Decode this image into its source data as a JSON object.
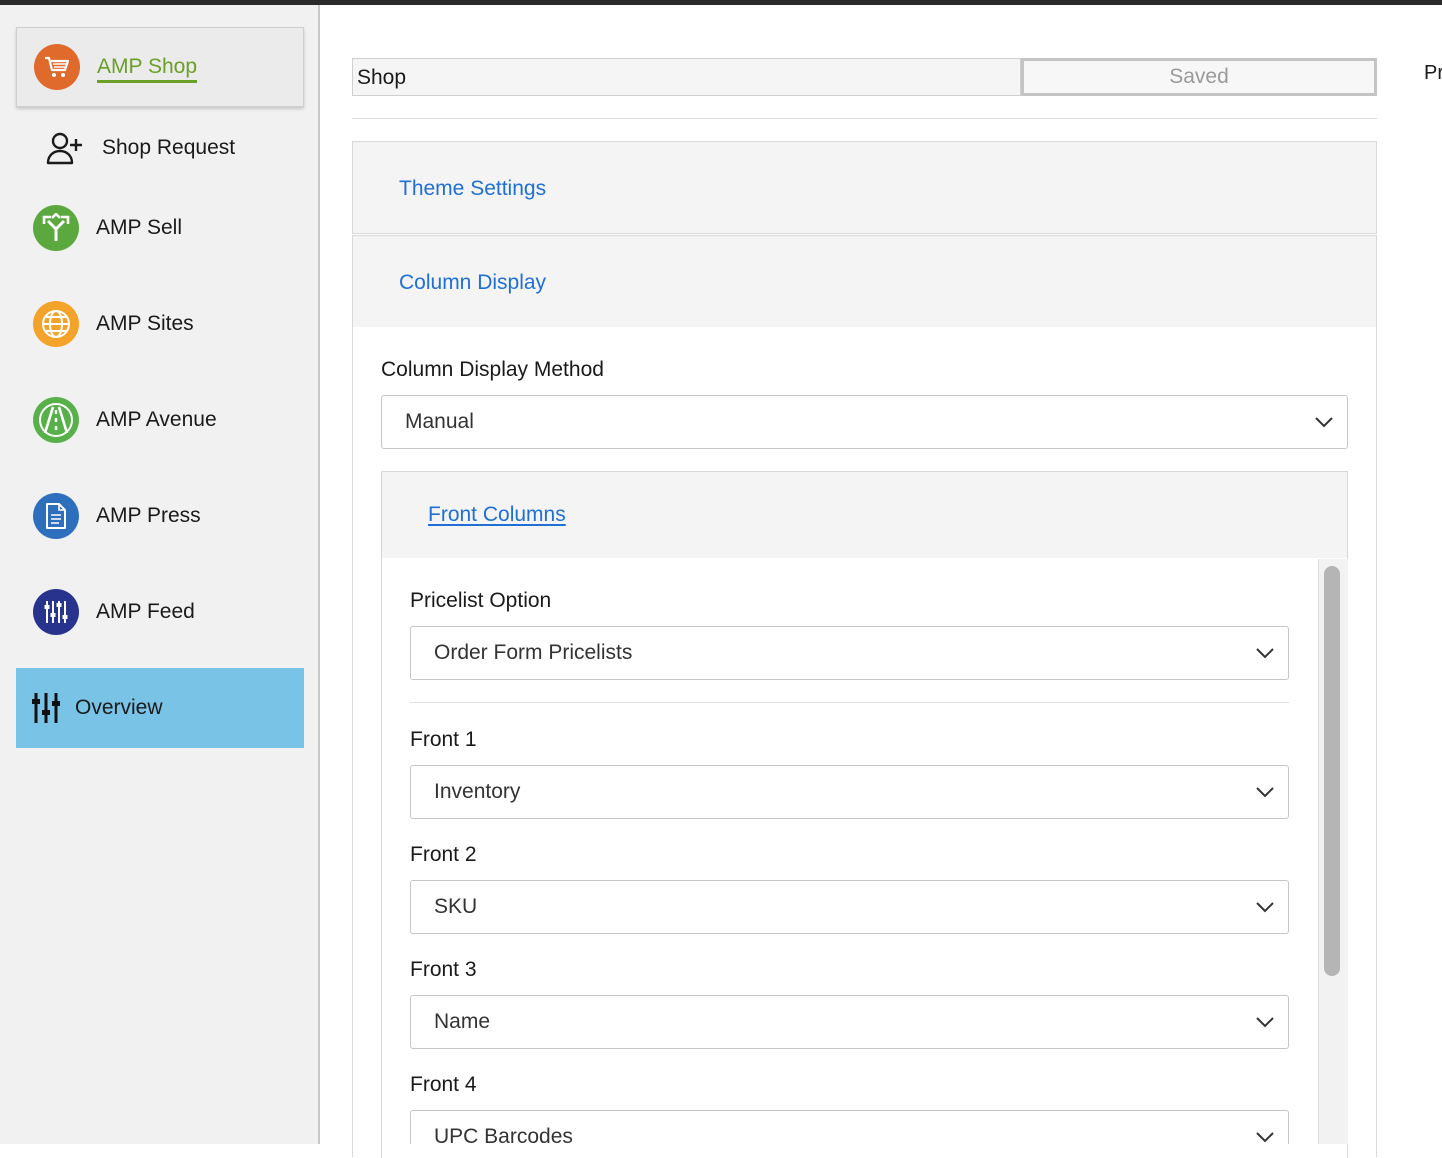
{
  "colors": {
    "shop_accent": "#e06a2c",
    "sell_green": "#5aa83e",
    "sites_orange": "#f4a32a",
    "avenue_green": "#58b04a",
    "press_blue": "#2d6fbc",
    "feed_navy": "#27338c",
    "overview_bg": "#79c3e6",
    "link_blue": "#1f6fd6"
  },
  "sidebar": {
    "items": [
      {
        "label": "AMP Shop",
        "icon": "cart-icon"
      },
      {
        "label": "Shop Request",
        "icon": "add-user-icon"
      },
      {
        "label": "AMP Sell",
        "icon": "arrows-split-icon"
      },
      {
        "label": "AMP Sites",
        "icon": "globe-icon"
      },
      {
        "label": "AMP Avenue",
        "icon": "road-icon"
      },
      {
        "label": "AMP Press",
        "icon": "document-icon"
      },
      {
        "label": "AMP Feed",
        "icon": "sliders-icon"
      },
      {
        "label": "Overview",
        "icon": "sliders-icon"
      }
    ]
  },
  "header": {
    "shop_name": "Shop",
    "saved_label": "Saved",
    "truncated_right": "Pr"
  },
  "panels": {
    "theme_settings": "Theme Settings",
    "column_display": "Column Display"
  },
  "column_display": {
    "method_label": "Column Display Method",
    "method_value": "Manual",
    "front_columns_title": "Front Columns",
    "pricelist_label": "Pricelist Option",
    "pricelist_value": "Order Form Pricelists",
    "fronts": [
      {
        "label": "Front 1",
        "value": "Inventory"
      },
      {
        "label": "Front 2",
        "value": "SKU"
      },
      {
        "label": "Front 3",
        "value": "Name"
      },
      {
        "label": "Front 4",
        "value": "UPC Barcodes"
      }
    ]
  }
}
